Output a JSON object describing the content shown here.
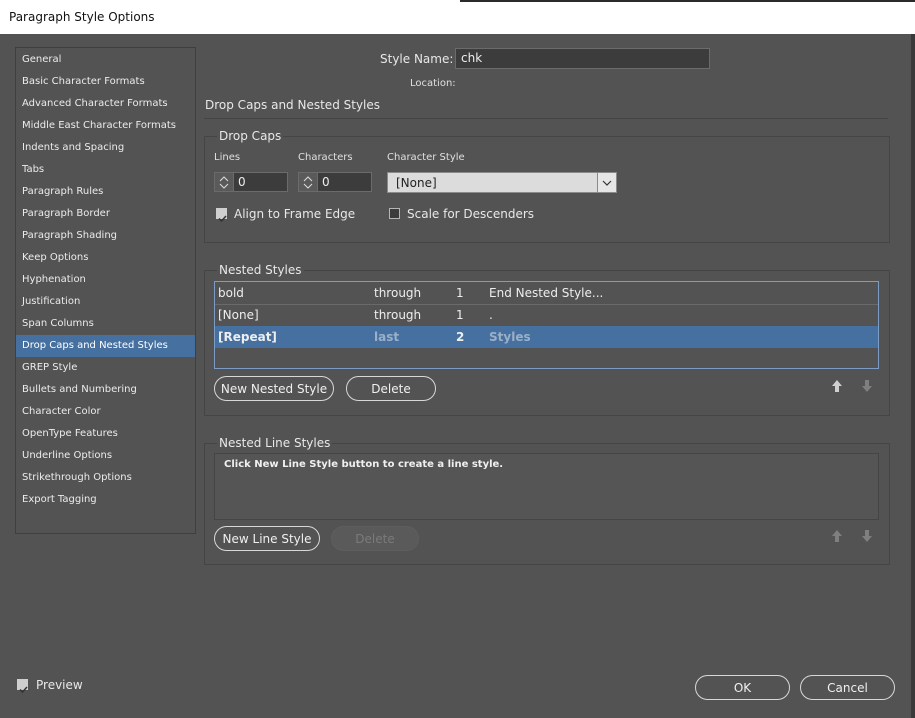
{
  "window": {
    "title": "Paragraph Style Options"
  },
  "sidebar": {
    "items": [
      {
        "label": "General"
      },
      {
        "label": "Basic Character Formats"
      },
      {
        "label": "Advanced Character Formats"
      },
      {
        "label": "Middle East Character Formats"
      },
      {
        "label": "Indents and Spacing"
      },
      {
        "label": "Tabs"
      },
      {
        "label": "Paragraph Rules"
      },
      {
        "label": "Paragraph Border"
      },
      {
        "label": "Paragraph Shading"
      },
      {
        "label": "Keep Options"
      },
      {
        "label": "Hyphenation"
      },
      {
        "label": "Justification"
      },
      {
        "label": "Span Columns"
      },
      {
        "label": "Drop Caps and Nested Styles",
        "selected": true
      },
      {
        "label": "GREP Style"
      },
      {
        "label": "Bullets and Numbering"
      },
      {
        "label": "Character Color"
      },
      {
        "label": "OpenType Features"
      },
      {
        "label": "Underline Options"
      },
      {
        "label": "Strikethrough Options"
      },
      {
        "label": "Export Tagging"
      }
    ]
  },
  "header": {
    "style_name_label": "Style Name:",
    "style_name_value": "chk",
    "location_label": "Location:",
    "section_title": "Drop Caps and Nested Styles"
  },
  "drop_caps": {
    "title": "Drop Caps",
    "lines_label": "Lines",
    "lines_value": "0",
    "characters_label": "Characters",
    "characters_value": "0",
    "character_style_label": "Character Style",
    "character_style_value": "[None]",
    "align_label": "Align to Frame Edge",
    "align_checked": true,
    "scale_label": "Scale for Descenders",
    "scale_checked": false
  },
  "nested_styles": {
    "title": "Nested Styles",
    "rows": [
      {
        "style": "bold",
        "mode": "through",
        "count": "1",
        "delimiter": "End Nested Style..."
      },
      {
        "style": "[None]",
        "mode": "through",
        "count": "1",
        "delimiter": "."
      },
      {
        "style": "[Repeat]",
        "mode": "last",
        "count": "2",
        "delimiter": "Styles"
      }
    ],
    "new_button": "New Nested Style",
    "delete_button": "Delete"
  },
  "nested_line_styles": {
    "title": "Nested Line Styles",
    "hint": "Click New Line Style button to create a line style.",
    "new_button": "New Line Style",
    "delete_button": "Delete"
  },
  "footer": {
    "preview_label": "Preview",
    "preview_checked": true,
    "ok_button": "OK",
    "cancel_button": "Cancel"
  },
  "colors": {
    "selection": "#46709f",
    "background": "#535353"
  },
  "icons": {
    "move_up": "arrow-up-icon",
    "move_down": "arrow-down-icon",
    "checkbox": "check-icon",
    "dropdown": "chevron-down-icon"
  }
}
